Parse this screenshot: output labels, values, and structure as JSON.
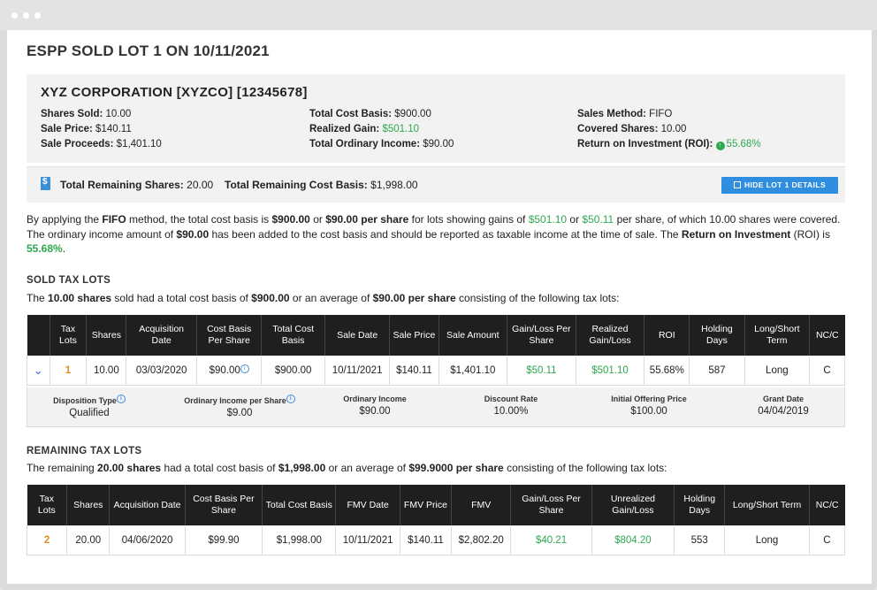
{
  "page_title": "ESPP SOLD LOT 1 ON 10/11/2021",
  "company": "XYZ CORPORATION [XYZCO] [12345678]",
  "summary": {
    "shares_sold_label": "Shares Sold:",
    "shares_sold": "10.00",
    "sale_price_label": "Sale Price:",
    "sale_price": "$140.11",
    "sale_proceeds_label": "Sale Proceeds:",
    "sale_proceeds": "$1,401.10",
    "total_cost_basis_label": "Total Cost Basis:",
    "total_cost_basis": "$900.00",
    "realized_gain_label": "Realized Gain:",
    "realized_gain": "$501.10",
    "total_ordinary_income_label": "Total Ordinary Income:",
    "total_ordinary_income": "$90.00",
    "sales_method_label": "Sales Method:",
    "sales_method": "FIFO",
    "covered_shares_label": "Covered Shares:",
    "covered_shares": "10.00",
    "roi_label": "Return on Investment (ROI):",
    "roi": "55.68%"
  },
  "remaining": {
    "shares_label": "Total Remaining Shares:",
    "shares": "20.00",
    "cost_label": "Total Remaining Cost Basis:",
    "cost": "$1,998.00",
    "hide_button": "HIDE LOT 1 DETAILS"
  },
  "paragraph": {
    "p1": "By applying the ",
    "p2": "FIFO",
    "p3": " method, the total cost basis is ",
    "p4": "$900.00",
    "p5": " or ",
    "p6": "$90.00 per share",
    "p7": " for lots showing gains of ",
    "p8": "$501.10",
    "p9": " or ",
    "p10": "$50.11",
    "p11": " per share, of which 10.00 shares were covered. The ordinary income amount of ",
    "p12": "$90.00",
    "p13": " has been added to the cost basis and should be reported as taxable income at the time of sale. The ",
    "p14": "Return on Investment",
    "p15": " (ROI) is ",
    "p16": "55.68%",
    "p17": "."
  },
  "sold": {
    "title": "SOLD TAX LOTS",
    "d1": "The ",
    "d2": "10.00 shares",
    "d3": " sold had a total cost basis of ",
    "d4": "$900.00",
    "d5": " or an average of ",
    "d6": "$90.00 per share",
    "d7": " consisting of the following tax lots:",
    "headers": [
      "Tax Lots",
      "Shares",
      "Acquisition Date",
      "Cost Basis Per Share",
      "Total Cost Basis",
      "Sale Date",
      "Sale Price",
      "Sale Amount",
      "Gain/Loss Per Share",
      "Realized Gain/Loss",
      "ROI",
      "Holding Days",
      "Long/Short Term",
      "NC/C"
    ],
    "row": [
      "1",
      "10.00",
      "03/03/2020",
      "$90.00",
      "$900.00",
      "10/11/2021",
      "$140.11",
      "$1,401.10",
      "$50.11",
      "$501.10",
      "55.68%",
      "587",
      "Long",
      "C"
    ],
    "details": [
      {
        "label": "Disposition Type",
        "value": "Qualified"
      },
      {
        "label": "Ordinary Income per Share",
        "value": "$9.00"
      },
      {
        "label": "Ordinary Income",
        "value": "$90.00"
      },
      {
        "label": "Discount Rate",
        "value": "10.00%"
      },
      {
        "label": "Initial Offering Price",
        "value": "$100.00"
      },
      {
        "label": "Grant Date",
        "value": "04/04/2019"
      }
    ]
  },
  "remaining_lots": {
    "title": "REMAINING TAX LOTS",
    "d1": "The remaining ",
    "d2": "20.00 shares",
    "d3": " had a total cost basis of ",
    "d4": "$1,998.00",
    "d5": " or an average of ",
    "d6": "$99.9000 per share",
    "d7": " consisting of the following tax lots:",
    "headers": [
      "Tax Lots",
      "Shares",
      "Acquisition Date",
      "Cost Basis Per Share",
      "Total Cost Basis",
      "FMV Date",
      "FMV Price",
      "FMV",
      "Gain/Loss Per Share",
      "Unrealized Gain/Loss",
      "Holding Days",
      "Long/Short Term",
      "NC/C"
    ],
    "row": [
      "2",
      "20.00",
      "04/06/2020",
      "$99.90",
      "$1,998.00",
      "10/11/2021",
      "$140.11",
      "$2,802.20",
      "$40.21",
      "$804.20",
      "553",
      "Long",
      "C"
    ]
  },
  "colors": {
    "green": "#2ea84f",
    "accent": "#2f8ee0",
    "orange": "#e58a1f",
    "header": "#1f1f1f"
  }
}
